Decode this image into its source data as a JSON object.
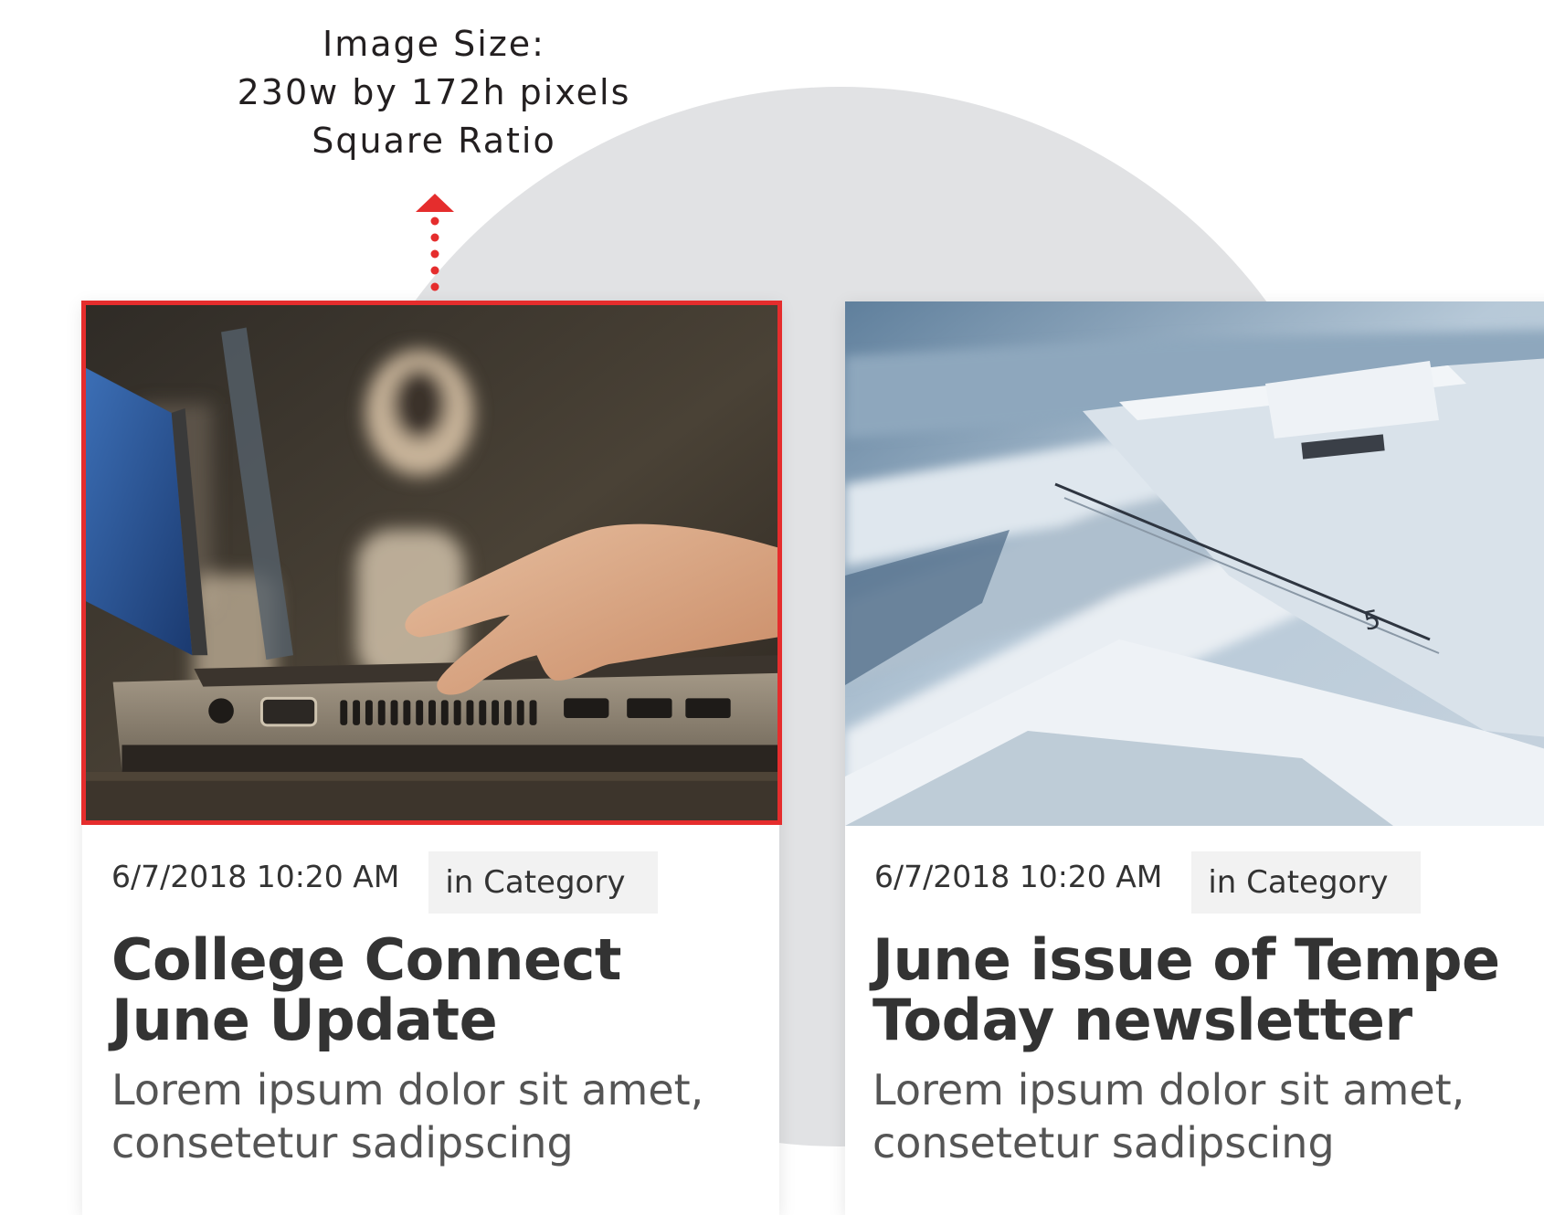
{
  "annotation": {
    "line1": "Image Size:",
    "line2": "230w by 172h pixels",
    "line3": "Square Ratio",
    "highlight_color": "#e52d2d"
  },
  "background": {
    "arc_color": "#e1e2e4"
  },
  "cards": [
    {
      "image_icon": "laptop-typing-photo",
      "date": "6/7/2018 10:20 AM",
      "category": "in Category",
      "title": "College Connect June Update",
      "excerpt": "Lorem ipsum dolor sit amet, consetetur sadipscing"
    },
    {
      "image_icon": "newspaper-stack-photo",
      "date": "6/7/2018 10:20 AM",
      "category": "in Category",
      "title": "June issue of Tempe Today newsletter",
      "excerpt": "Lorem ipsum dolor sit amet, consetetur sadipscing"
    }
  ]
}
